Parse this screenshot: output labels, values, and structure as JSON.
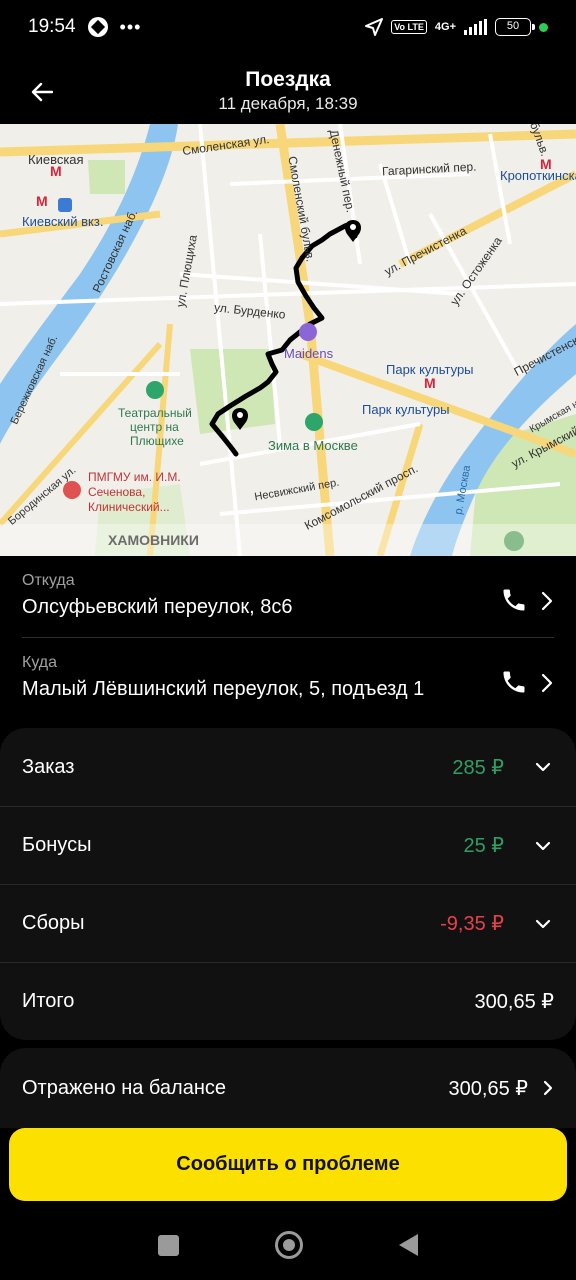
{
  "status_bar": {
    "time": "19:54",
    "dots": "•••",
    "volte": "Vo LTE",
    "network": "4G+",
    "battery": "50"
  },
  "header": {
    "title": "Поездка",
    "subtitle": "11 декабря, 18:39"
  },
  "map": {
    "labels": {
      "kievskaya": "Киевская",
      "kievskiy_vkz": "Киевский вкз.",
      "smolenskaya": "Смоленская ул.",
      "denezhny": "Денежный пер.",
      "gagarinsky": "Гагаринский пер.",
      "kropotkinskaya": "Кропоткинская",
      "bulv": "бульв.",
      "rostovskaya": "Ростовская наб.",
      "pl": "ул. Плющиха",
      "smolensky_bulv": "Смоленский бульв.",
      "prechistenka": "ул. Пречистенка",
      "ostozhenka": "ул. Остоженка",
      "burdenko": "ул. Бурденко",
      "maidens": "Maidens",
      "park1": "Парк культуры",
      "park2": "Парк культуры",
      "teatr1": "Театральный",
      "teatr2": "центр на",
      "teatr3": "Плющихе",
      "zima": "Зима в Москве",
      "pmgmu1": "ПМГМУ им. И.М.",
      "pmgmu2": "Сеченова,",
      "pmgmu3": "Клинический...",
      "neskuchny": "Несвижский пер.",
      "komsomolsky": "Комсомольский просп.",
      "moskva": "р. Москва",
      "krymsky": "ул. Крымский",
      "khamovniki": "ХАМОВНИКИ",
      "berezhkovskaya": "Бережковская наб.",
      "prechistenskaya": "Пречистенская",
      "krymskaya_nab": "Крымская наб.",
      "borodinskaya": "Бородинская ул."
    }
  },
  "route": {
    "from_label": "Откуда",
    "from_address": "Олсуфьевский переулок, 8с6",
    "to_label": "Куда",
    "to_address": "Малый Лёвшинский переулок, 5, подъезд 1"
  },
  "summary": {
    "order_label": "Заказ",
    "order_value": "285 ₽",
    "bonus_label": "Бонусы",
    "bonus_value": "25 ₽",
    "fees_label": "Сборы",
    "fees_value": "-9,35 ₽",
    "total_label": "Итого",
    "total_value": "300,65 ₽"
  },
  "balance": {
    "label": "Отражено на балансе",
    "value": "300,65 ₽"
  },
  "cta": {
    "label": "Сообщить о проблеме"
  },
  "colors": {
    "positive": "#2f9e62",
    "negative": "#e5414b",
    "accent": "#fce000"
  }
}
